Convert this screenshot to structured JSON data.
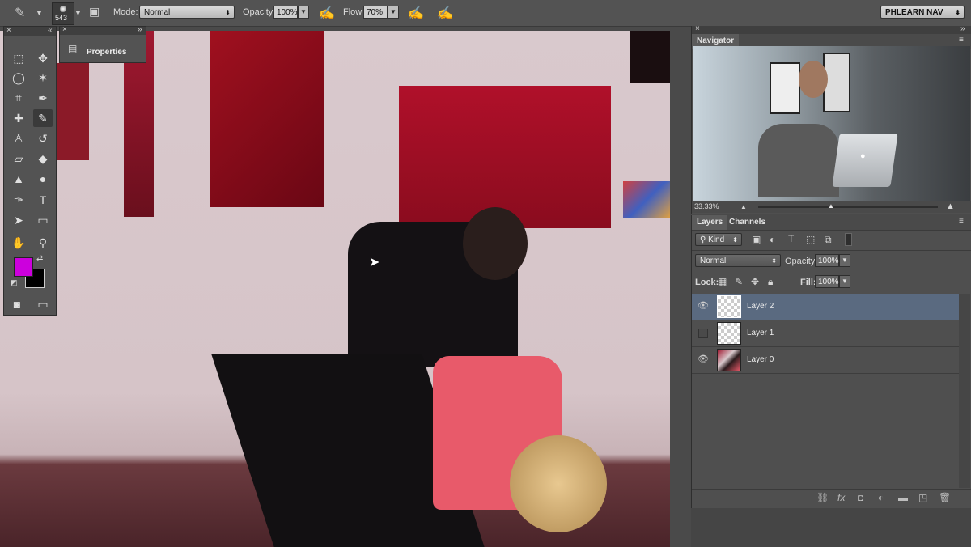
{
  "optionsbar": {
    "brush_size": "543",
    "mode_label": "Mode:",
    "mode_value": "Normal",
    "opacity_label": "Opacity:",
    "opacity_value": "100%",
    "flow_label": "Flow:",
    "flow_value": "70%",
    "workspace": "PHLEARN NAV"
  },
  "properties_panel": {
    "label": "Properties"
  },
  "tools": {
    "foreground_color": "#cc00dd",
    "background_color": "#000000",
    "items": [
      "marquee-icon",
      "move-icon",
      "lasso-icon",
      "magic-wand-icon",
      "crop-icon",
      "eyedropper-icon",
      "healing-brush-icon",
      "brush-icon",
      "clone-stamp-icon",
      "history-brush-icon",
      "eraser-icon",
      "paint-bucket-icon",
      "blur-icon",
      "dodge-icon",
      "pen-icon",
      "type-icon",
      "path-selection-icon",
      "rectangle-icon",
      "hand-icon",
      "zoom-icon"
    ]
  },
  "navigator": {
    "title": "Navigator",
    "zoom": "33.33%"
  },
  "layers": {
    "tab_layers": "Layers",
    "tab_channels": "Channels",
    "filter_kind": "Kind",
    "blend_mode": "Normal",
    "opacity_label": "Opacity:",
    "opacity_value": "100%",
    "lock_label": "Lock:",
    "fill_label": "Fill:",
    "fill_value": "100%",
    "rows": [
      {
        "name": "Layer 2",
        "visible": true,
        "selected": true
      },
      {
        "name": "Layer 1",
        "visible": false,
        "selected": false
      },
      {
        "name": "Layer 0",
        "visible": true,
        "selected": false
      }
    ]
  }
}
